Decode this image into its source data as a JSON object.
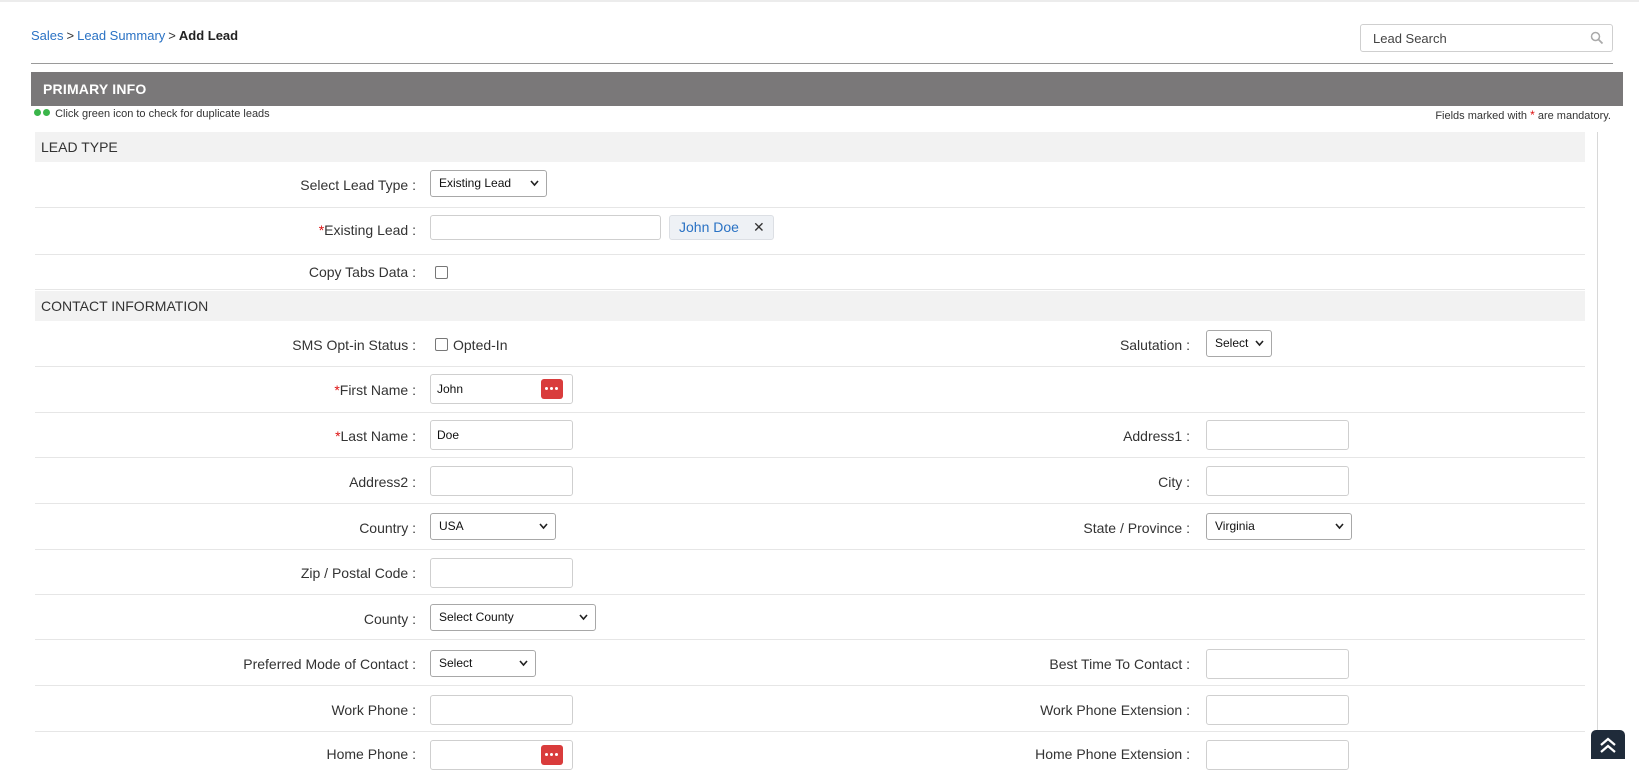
{
  "breadcrumb": {
    "item1": "Sales",
    "sep1": ">",
    "item2": "Lead Summary",
    "sep2": ">",
    "current": "Add Lead"
  },
  "search": {
    "placeholder": "Lead Search",
    "icon": "magnifier-icon"
  },
  "banner": {
    "title": "PRIMARY INFO"
  },
  "hint": {
    "text": "Click green icon to check for duplicate leads",
    "dot_color": "#3ab54a"
  },
  "mandatory_note": {
    "prefix": "Fields marked with",
    "star": "*",
    "suffix": "are mandatory."
  },
  "sections": {
    "lead_type": "LEAD TYPE",
    "contact": "CONTACT INFORMATION"
  },
  "form": {
    "lead_type_label": "Select Lead Type :",
    "lead_type_value": "Existing Lead",
    "existing_lead_label": "Existing Lead :",
    "existing_lead_chip": "John Doe",
    "chip_remove": "✕",
    "copy_tabs_label": "Copy Tabs Data :",
    "copy_tabs_checked": false,
    "sms_label": "SMS Opt-in Status :",
    "sms_option": "Opted-In",
    "sms_checked": false,
    "salutation_label": "Salutation :",
    "salutation_value": "Select",
    "first_name_label": "First Name :",
    "first_name_value": "John",
    "last_name_label": "Last Name :",
    "last_name_value": "Doe",
    "address1_label": "Address1 :",
    "address2_label": "Address2 :",
    "city_label": "City :",
    "country_label": "Country :",
    "country_value": "USA",
    "state_label": "State / Province :",
    "state_value": "Virginia",
    "zip_label": "Zip / Postal Code :",
    "county_label": "County :",
    "county_value": "Select County",
    "pref_contact_label": "Preferred Mode of Contact :",
    "pref_contact_value": "Select",
    "best_time_label": "Best Time To Contact :",
    "work_phone_label": "Work Phone :",
    "work_ext_label": "Work Phone Extension :",
    "home_phone_label": "Home Phone :",
    "home_ext_label": "Home Phone Extension :"
  },
  "colors": {
    "banner_bg": "#7a7879",
    "link": "#2a72c4",
    "required": "#d11111",
    "key_icon": "#d93c3c",
    "to_top_bg": "#1f2b3a"
  }
}
